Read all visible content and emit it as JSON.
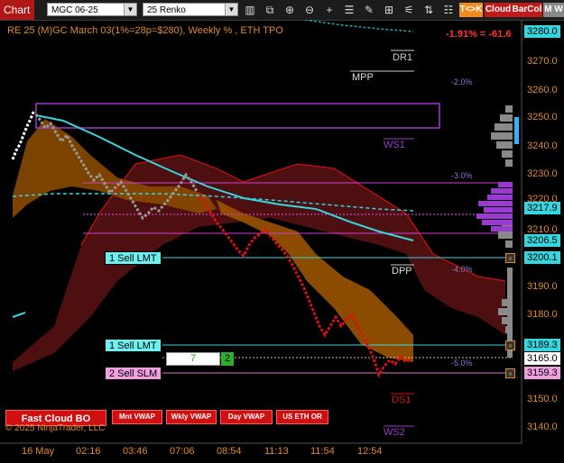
{
  "toolbar": {
    "chart_tab": "Chart",
    "instrument": "MGC 06-25",
    "bar_type": "25 Renko",
    "btn_tk": "T<>K",
    "btn_cloud": "Cloud",
    "btn_barcol": "BarCol",
    "btn_mw": "M W"
  },
  "header": {
    "title": "RE 25 (M)GC March 03(1%=28p=$280), Weekly % , ETH TPO",
    "change": "-1.91% = -61.6"
  },
  "price_axis": [
    "3270.0",
    "3260.0",
    "3250.0",
    "3240.0",
    "3230.0",
    "3220.0",
    "3210.0",
    "3190.0",
    "3180.0",
    "3150.0",
    "3140.0"
  ],
  "price_tags": {
    "top": "3280.0",
    "p3217": "3217.9",
    "p3206": "3206.5",
    "p3200": "3200.1",
    "p3189": "3189.3",
    "p3165": "3165.0",
    "p3159": "3159.3"
  },
  "time_axis": [
    "16 May",
    "02:16",
    "03:46",
    "07:06",
    "08:54",
    "11:13",
    "11:54",
    "12:54"
  ],
  "levels": {
    "dr1": "DR1",
    "mpp": "MPP",
    "ws1": "WS1",
    "dpp": "DPP",
    "ds1": "DS1",
    "ws2": "WS2",
    "pct_m2": "-2.0%",
    "pct_m3": "-3.0%",
    "pct_m4": "-4.0%",
    "pct_m5": "-5.0%"
  },
  "orders": {
    "sell_lmt_1": "1 Sell LMT",
    "sell_lmt_2": "1 Sell LMT",
    "sell_slm": "2 Sell SLM",
    "qty_input": "7",
    "qty_badge": "2"
  },
  "bottom_buttons": {
    "fast_cloud": "Fast Cloud BO",
    "mnt_vwap": "Mnt VWAP",
    "wkly_vwap": "Wkly VWAP",
    "day_vwap": "Day VWAP",
    "us_eth_or": "US ETH OR"
  },
  "copyright": "© 2025 NinjaTrader, LLC",
  "colors": {
    "background": "#000000",
    "axis": "#e08a2a",
    "cyan": "#36d6e0",
    "magenta": "#d040d0",
    "red": "#e01010",
    "orange_cloud": "#a05a00",
    "dark_cloud": "#5a1010"
  }
}
